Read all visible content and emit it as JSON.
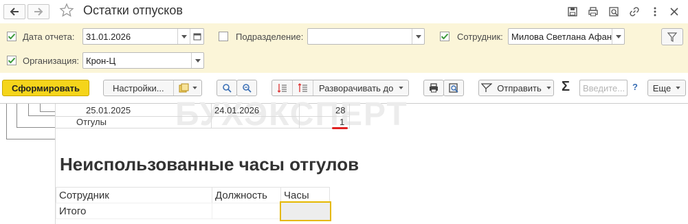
{
  "window": {
    "title": "Остатки отпусков"
  },
  "filters": {
    "report_date": {
      "label": "Дата отчета:",
      "value": "31.01.2026",
      "checked": true
    },
    "division": {
      "label": "Подразделение:",
      "value": "",
      "checked": false
    },
    "employee": {
      "label": "Сотрудник:",
      "value": "Милова Светлана Афан",
      "checked": true
    },
    "organization": {
      "label": "Организация:",
      "value": "Крон-Ц",
      "checked": true
    }
  },
  "toolbar": {
    "generate_label": "Сформировать",
    "settings_label": "Настройки...",
    "expand_label": "Разворачивать до",
    "send_label": "Отправить",
    "sum_symbol": "Σ",
    "input_placeholder": "Введите...",
    "help_label": "?",
    "more_label": "Еще"
  },
  "report": {
    "watermark": "БУХЭКСПЕРТ",
    "rows": [
      {
        "col1": "25.01.2025",
        "col2": "24.01.2026",
        "col3": "28"
      },
      {
        "col1": "Отгулы",
        "col2": "",
        "col3": "1"
      }
    ],
    "section_title": "Неиспользованные часы отгулов",
    "table_headers": [
      "Сотрудник",
      "Должность",
      "Часы"
    ],
    "total_label": "Итого"
  },
  "colors": {
    "accent": "#f5d51b",
    "filter_bg": "#fbf5d8",
    "check_green": "#3c9a3c",
    "underline_red": "#e02020",
    "selected_cell": "#e5b800"
  }
}
